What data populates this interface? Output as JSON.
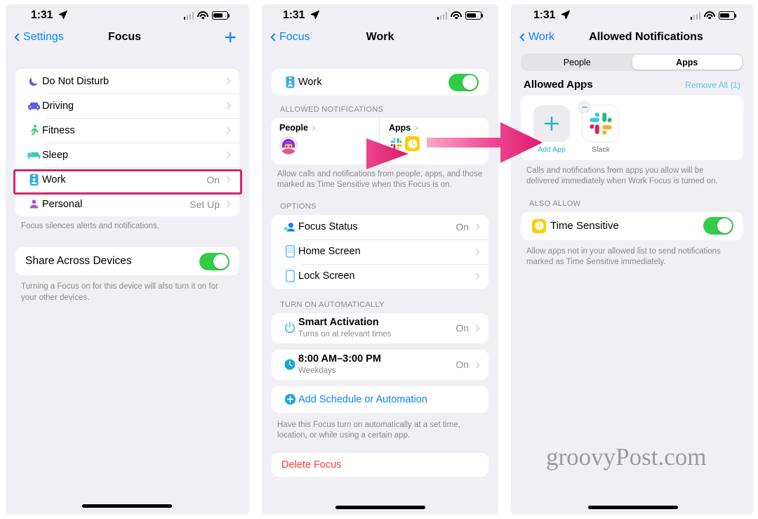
{
  "statusbar": {
    "time": "1:31",
    "location_icon": "location-arrow-icon",
    "signal_icon": "cellular-bars-icon",
    "wifi_icon": "wifi-icon",
    "battery_icon": "battery-icon"
  },
  "phone1": {
    "nav": {
      "back_label": "Settings",
      "title": "Focus",
      "add_label": "+"
    },
    "focus_list": [
      {
        "label": "Do Not Disturb",
        "value": "",
        "icon": "moon-icon",
        "color": "#5e5ce6"
      },
      {
        "label": "Driving",
        "value": "",
        "icon": "car-icon",
        "color": "#5e5ce6"
      },
      {
        "label": "Fitness",
        "value": "",
        "icon": "running-person-icon",
        "color": "#30d158"
      },
      {
        "label": "Sleep",
        "value": "",
        "icon": "bed-icon",
        "color": "#30c8c0"
      },
      {
        "label": "Work",
        "value": "On",
        "icon": "id-badge-icon",
        "color": "#32ade6"
      },
      {
        "label": "Personal",
        "value": "Set Up",
        "icon": "person-icon",
        "color": "#af52de"
      }
    ],
    "focus_footnote": "Focus silences alerts and notifications.",
    "share": {
      "label": "Share Across Devices",
      "toggle_on": true,
      "footnote": "Turning a Focus on for this device will also turn it on for your other devices."
    },
    "highlight_row": "Work"
  },
  "phone2": {
    "nav": {
      "back_label": "Focus",
      "title": "Work"
    },
    "work_toggle": {
      "label": "Work",
      "icon": "id-badge-icon",
      "toggle_on": true
    },
    "allowed_notifications": {
      "header": "ALLOWED NOTIFICATIONS",
      "people_card": {
        "title": "People",
        "avatar": "memoji-avatar"
      },
      "apps_card": {
        "title": "Apps",
        "apps": [
          "slack-icon",
          "clock-icon"
        ]
      },
      "footnote": "Allow calls and notifications from people, apps, and those marked as Time Sensitive when this Focus is on."
    },
    "options": {
      "header": "OPTIONS",
      "items": [
        {
          "label": "Focus Status",
          "value": "On",
          "icon": "focus-status-icon",
          "color": "#32ade6"
        },
        {
          "label": "Home Screen",
          "value": "",
          "icon": "home-screen-icon",
          "color": "#32ade6"
        },
        {
          "label": "Lock Screen",
          "value": "",
          "icon": "lock-screen-icon",
          "color": "#32ade6"
        }
      ]
    },
    "automation": {
      "header": "TURN ON AUTOMATICALLY",
      "items": [
        {
          "title": "Smart Activation",
          "subtitle": "Turns on at relevant times",
          "value": "On",
          "icon": "power-icon"
        },
        {
          "title": "8:00 AM–3:00 PM",
          "subtitle": "Weekdays",
          "value": "On",
          "icon": "clock-filled-icon"
        }
      ],
      "add_label": "Add Schedule or Automation",
      "add_icon": "plus-circle-icon",
      "footnote": "Have this Focus turn on automatically at a set time, location, or while using a certain app."
    },
    "delete_label": "Delete Focus"
  },
  "phone3": {
    "nav": {
      "back_label": "Work",
      "title": "Allowed Notifications"
    },
    "segments": [
      {
        "label": "People",
        "active": false
      },
      {
        "label": "Apps",
        "active": true
      }
    ],
    "allowed_apps": {
      "header": "Allowed Apps",
      "remove_all_label": "Remove All (1)",
      "tiles": [
        {
          "label": "Add App",
          "icon": "plus-icon",
          "kind": "add"
        },
        {
          "label": "Slack",
          "icon": "slack-icon",
          "kind": "app",
          "removable": true
        }
      ],
      "footnote": "Calls and notifications from apps you allow will be delivered immediately when Work Focus is turned on."
    },
    "also_allow": {
      "header": "ALSO ALLOW",
      "label": "Time Sensitive",
      "icon": "time-sensitive-icon",
      "toggle_on": true,
      "footnote": "Allow apps not in your allowed list to send notifications marked as Time Sensitive immediately."
    }
  },
  "annotations": {
    "arrow_inner_label": "arrow-to-apps-card",
    "arrow_between_label": "arrow-to-allowed-apps",
    "arrow_color_start": "#f7a0c0",
    "arrow_color_end": "#e02a72",
    "highlight_color": "#d6246e"
  },
  "watermark": {
    "text": "groovyPost.com"
  }
}
